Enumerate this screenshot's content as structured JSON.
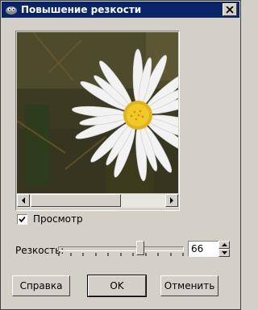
{
  "window": {
    "title": "Повышение резкости"
  },
  "preview": {
    "label": "Просмотр",
    "checked": true
  },
  "sharpness": {
    "label": "Резкость:",
    "value": "66",
    "level_percent": 66
  },
  "buttons": {
    "help": "Справка",
    "ok": "OK",
    "cancel": "Отменить"
  },
  "icons": {
    "app": "gimp-icon",
    "close": "close-icon",
    "left": "arrow-left-icon",
    "right": "arrow-right-icon"
  }
}
